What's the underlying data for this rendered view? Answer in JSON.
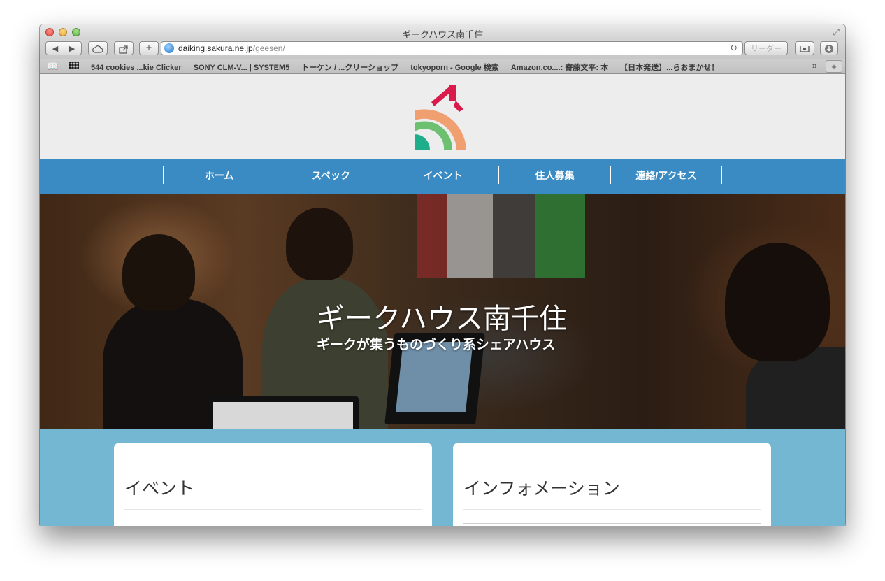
{
  "window": {
    "title": "ギークハウス南千住"
  },
  "toolbar": {
    "back_label": "◀",
    "forward_label": "▶",
    "add_label": "+",
    "url_host": "daiking.sakura.ne.jp",
    "url_path": "/geesen/",
    "reader_label": "リーダー"
  },
  "bookmarks": {
    "items": [
      "544 cookies ...kie Clicker",
      "SONY CLM-V... | SYSTEM5",
      "トーケン / ...クリーショップ",
      "tokyoporn - Google 検索",
      "Amazon.co....: 寄藤文平: 本",
      "【日本発送】...らおまかせ！"
    ],
    "more_label": "»",
    "newtab_label": "+"
  },
  "nav": {
    "items": [
      "ホーム",
      "スペック",
      "イベント",
      "住人募集",
      "連絡/アクセス"
    ]
  },
  "hero": {
    "title": "ギークハウス南千住",
    "subtitle": "ギークが集うものづくり系シェアハウス"
  },
  "cards": {
    "events_title": "イベント",
    "info_title": "インフォメーション"
  },
  "colors": {
    "nav_bg": "#3a8bc3",
    "content_bg": "#74b7d2",
    "logo_red": "#d81b4a",
    "logo_orange": "#f0a070",
    "logo_green": "#6cc070",
    "logo_teal": "#1fae8c"
  }
}
